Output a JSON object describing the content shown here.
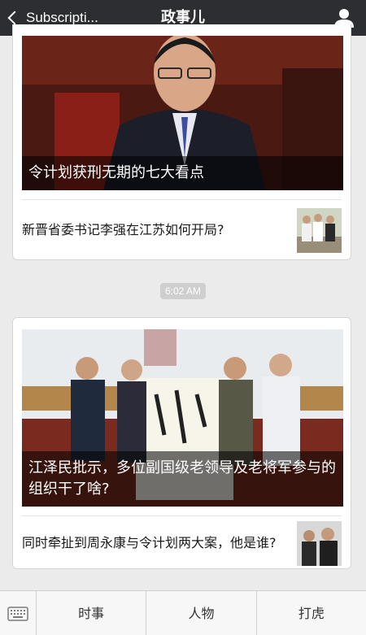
{
  "navbar": {
    "back_label": "Subscripti...",
    "title": "政事儿"
  },
  "messages": [
    {
      "cover_caption": "令计划获刑无期的七大看点",
      "sub_item": "新晋省委书记李强在江苏如何开局?"
    },
    {
      "cover_caption": "江泽民批示，多位副国级老领导及老将军参与的组织干了啥?",
      "sub_item": "同时牵扯到周永康与令计划两大案，他是谁?"
    }
  ],
  "timestamp": "6:02 AM",
  "bottom_menu": [
    "时事",
    "人物",
    "打虎"
  ],
  "icons": {
    "back": "chevron-left-icon",
    "profile": "person-icon",
    "keyboard": "keyboard-icon"
  },
  "colors": {
    "navbar": "#2d2e32",
    "background": "#ebebeb",
    "caption_overlay": "rgba(0,0,0,0.55)"
  }
}
